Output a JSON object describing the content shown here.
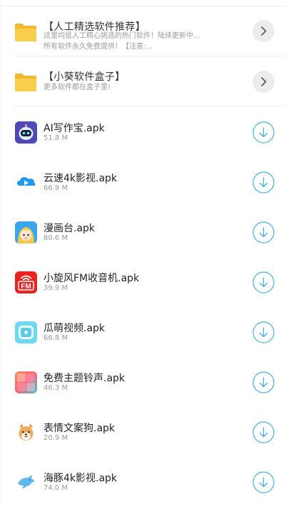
{
  "folders": [
    {
      "title": "【人工精选软件推荐】",
      "desc": "这里均是人工精心挑选的热门软件！陆续更新中...所有软件永久免费提供！【注意:...",
      "icon": "folder-icon"
    },
    {
      "title": "【小葵软件盒子】",
      "desc": "更多软件都在盒子里!",
      "icon": "folder-icon"
    }
  ],
  "files": [
    {
      "name": "AI写作宝.apk",
      "size": "51.8 M",
      "icon": "robot-app-icon"
    },
    {
      "name": "云速4k影视.apk",
      "size": "66.9 M",
      "icon": "cloud-play-app-icon"
    },
    {
      "name": "漫画台.apk",
      "size": "80.6 M",
      "icon": "anime-girl-app-icon"
    },
    {
      "name": "小旋风FM收音机.apk",
      "size": "39.9 M",
      "icon": "fm-radio-app-icon"
    },
    {
      "name": "瓜萌视频.apk",
      "size": "66.8 M",
      "icon": "tv-screen-app-icon"
    },
    {
      "name": "免费主题铃声.apk",
      "size": "46.3 M",
      "icon": "ringtone-app-icon"
    },
    {
      "name": "表情文案狗.apk",
      "size": "20.9 M",
      "icon": "shiba-dog-app-icon"
    },
    {
      "name": "海豚4k影视.apk",
      "size": "74.0 M",
      "icon": "dolphin-app-icon"
    }
  ],
  "colors": {
    "folder": "#f5c542",
    "download": "#3fb1e8",
    "chevron_bg": "#ececec",
    "divider": "#f2f2f2"
  }
}
